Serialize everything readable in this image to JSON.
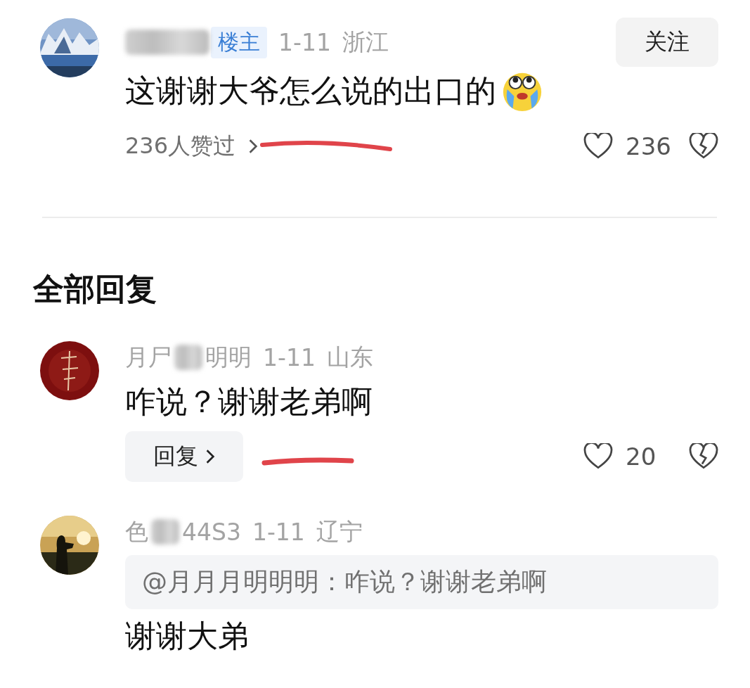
{
  "main_comment": {
    "avatar": {
      "kind": "mountains"
    },
    "author_blurred": true,
    "badge": "楼主",
    "date": "1-11",
    "location": "浙江",
    "follow_button": "关注",
    "text": "这谢谢大爷怎么说的出口的",
    "emoji": true,
    "likes_summary": "236人赞过",
    "likes_summary_marked": true,
    "like_count": "236"
  },
  "replies_title": "全部回复",
  "replies": [
    {
      "kind": "reply",
      "avatar": {
        "kind": "seal"
      },
      "name_parts": [
        "月尸",
        "明明"
      ],
      "date": "1-11",
      "location": "山东",
      "text": "咋说？谢谢老弟啊",
      "reply_button": "回复",
      "reply_button_marked": true,
      "like_count": "20"
    },
    {
      "kind": "quote_reply",
      "avatar": {
        "kind": "sunset"
      },
      "name_parts": [
        "色",
        "44S3"
      ],
      "date": "1-11",
      "location": "辽宁",
      "quote": "@月月月明明明：咋说？谢谢老弟啊",
      "text": "谢谢大弟"
    }
  ]
}
